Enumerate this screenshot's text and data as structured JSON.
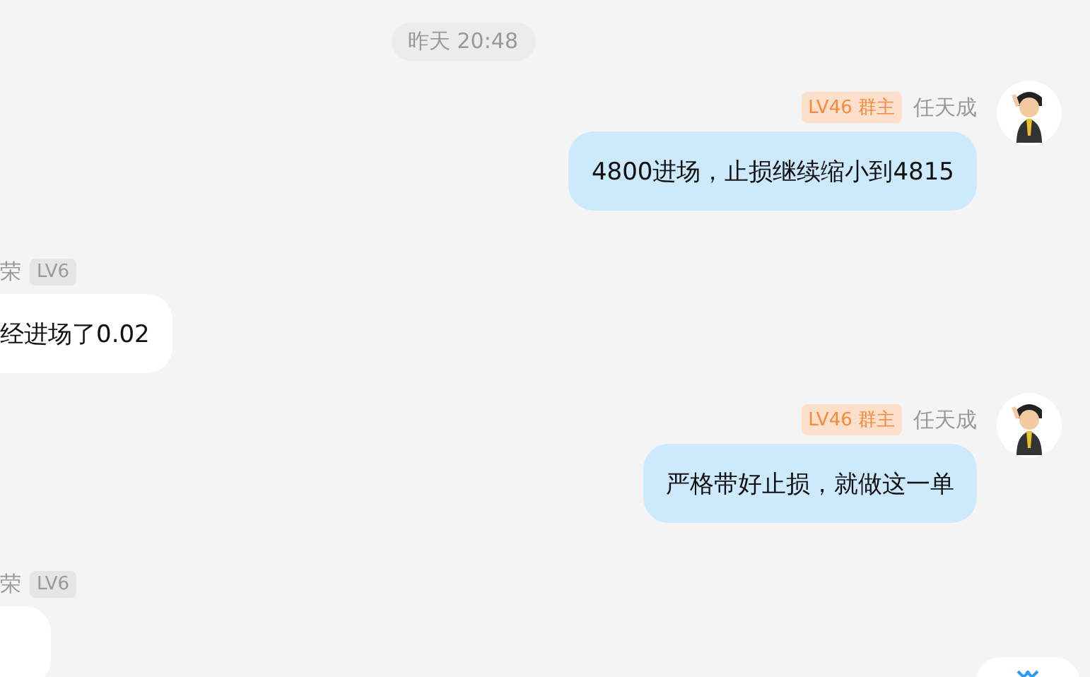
{
  "messages": [
    {
      "kind": "time",
      "text": "昨天 20:48"
    },
    {
      "kind": "out",
      "badge": "LV46 群主",
      "name": "任天成",
      "text": "4800进场，止损继续缩小到4815"
    },
    {
      "kind": "in",
      "name": "荣",
      "badge": "LV6",
      "text": "经进场了0.02"
    },
    {
      "kind": "out",
      "badge": "LV46 群主",
      "name": "任天成",
      "text": "严格带好止损，就做这一单"
    },
    {
      "kind": "in",
      "name": "荣",
      "badge": "LV6"
    }
  ]
}
